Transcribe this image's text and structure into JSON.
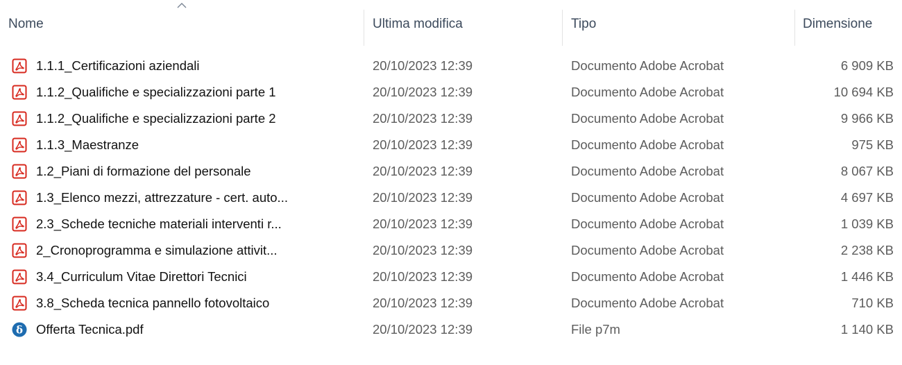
{
  "columns": {
    "name": "Nome",
    "modified": "Ultima modifica",
    "type": "Tipo",
    "size": "Dimensione"
  },
  "sort": {
    "column": "name",
    "direction": "ascending",
    "icon": "chevron-up-icon"
  },
  "colors": {
    "pdf_icon": "#d7281e",
    "p7m_icon": "#1e6cb0",
    "header_text": "#3c4a5c"
  },
  "files": [
    {
      "name": "1.1.1_Certificazioni aziendali",
      "modified": "20/10/2023 12:39",
      "type": "Documento Adobe Acrobat",
      "size": "6 909 KB",
      "icon": "pdf-icon"
    },
    {
      "name": "1.1.2_Qualifiche e specializzazioni parte 1",
      "modified": "20/10/2023 12:39",
      "type": "Documento Adobe Acrobat",
      "size": "10 694 KB",
      "icon": "pdf-icon"
    },
    {
      "name": "1.1.2_Qualifiche e specializzazioni parte 2",
      "modified": "20/10/2023 12:39",
      "type": "Documento Adobe Acrobat",
      "size": "9 966 KB",
      "icon": "pdf-icon"
    },
    {
      "name": "1.1.3_Maestranze",
      "modified": "20/10/2023 12:39",
      "type": "Documento Adobe Acrobat",
      "size": "975 KB",
      "icon": "pdf-icon"
    },
    {
      "name": "1.2_Piani di formazione del personale",
      "modified": "20/10/2023 12:39",
      "type": "Documento Adobe Acrobat",
      "size": "8 067 KB",
      "icon": "pdf-icon"
    },
    {
      "name": "1.3_Elenco mezzi, attrezzature - cert. auto...",
      "modified": "20/10/2023 12:39",
      "type": "Documento Adobe Acrobat",
      "size": "4 697 KB",
      "icon": "pdf-icon"
    },
    {
      "name": "2.3_Schede tecniche materiali interventi r...",
      "modified": "20/10/2023 12:39",
      "type": "Documento Adobe Acrobat",
      "size": "1 039 KB",
      "icon": "pdf-icon"
    },
    {
      "name": "2_Cronoprogramma e simulazione attivit...",
      "modified": "20/10/2023 12:39",
      "type": "Documento Adobe Acrobat",
      "size": "2 238 KB",
      "icon": "pdf-icon"
    },
    {
      "name": "3.4_Curriculum Vitae Direttori Tecnici",
      "modified": "20/10/2023 12:39",
      "type": "Documento Adobe Acrobat",
      "size": "1 446 KB",
      "icon": "pdf-icon"
    },
    {
      "name": "3.8_Scheda tecnica pannello fotovoltaico",
      "modified": "20/10/2023 12:39",
      "type": "Documento Adobe Acrobat",
      "size": "710 KB",
      "icon": "pdf-icon"
    },
    {
      "name": "Offerta Tecnica.pdf",
      "modified": "20/10/2023 12:39",
      "type": "File p7m",
      "size": "1 140 KB",
      "icon": "p7m-signed-file-icon"
    }
  ]
}
